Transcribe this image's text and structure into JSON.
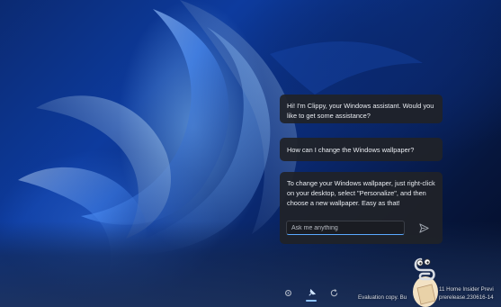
{
  "chat": {
    "assistant_greeting": "Hi! I'm Clippy, your Windows assistant. Would you like to get some assistance?",
    "user_message": "How can I change the Windows wallpaper?",
    "assistant_reply": "To change your Windows wallpaper, just right-click on your desktop, select \"Personalize\", and then choose a new wallpaper. Easy as that!",
    "input_placeholder": "Ask me anything",
    "send_icon": "send-icon"
  },
  "watermark": {
    "line1": "11 Home Insider Previ",
    "line2": "Evaluation copy. Bu",
    "line3": "prerelease.230616-14"
  },
  "taskbar": {
    "icons": [
      "gear-icon",
      "pin-icon",
      "refresh-icon"
    ]
  },
  "colors": {
    "accent": "#5aa9ff",
    "bubble_bg": "#202228",
    "wallpaper_blue": "#0d3b9e"
  }
}
